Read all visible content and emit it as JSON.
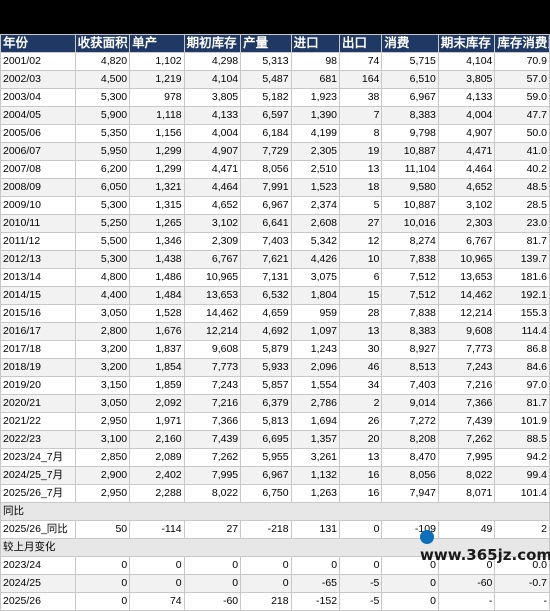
{
  "headers": [
    "年份",
    "收获面积",
    "单产",
    "期初库存",
    "产量",
    "进口",
    "出口",
    "消费",
    "期末库存",
    "库存消费比"
  ],
  "rows": [
    [
      "2001/02",
      "4,820",
      "1,102",
      "4,298",
      "5,313",
      "98",
      "74",
      "5,715",
      "4,104",
      "70.9"
    ],
    [
      "2002/03",
      "4,500",
      "1,219",
      "4,104",
      "5,487",
      "681",
      "164",
      "6,510",
      "3,805",
      "57.0"
    ],
    [
      "2003/04",
      "5,300",
      "978",
      "3,805",
      "5,182",
      "1,923",
      "38",
      "6,967",
      "4,133",
      "59.0"
    ],
    [
      "2004/05",
      "5,900",
      "1,118",
      "4,133",
      "6,597",
      "1,390",
      "7",
      "8,383",
      "4,004",
      "47.7"
    ],
    [
      "2005/06",
      "5,350",
      "1,156",
      "4,004",
      "6,184",
      "4,199",
      "8",
      "9,798",
      "4,907",
      "50.0"
    ],
    [
      "2006/07",
      "5,950",
      "1,299",
      "4,907",
      "7,729",
      "2,305",
      "19",
      "10,887",
      "4,471",
      "41.0"
    ],
    [
      "2007/08",
      "6,200",
      "1,299",
      "4,471",
      "8,056",
      "2,510",
      "13",
      "11,104",
      "4,464",
      "40.2"
    ],
    [
      "2008/09",
      "6,050",
      "1,321",
      "4,464",
      "7,991",
      "1,523",
      "18",
      "9,580",
      "4,652",
      "48.5"
    ],
    [
      "2009/10",
      "5,300",
      "1,315",
      "4,652",
      "6,967",
      "2,374",
      "5",
      "10,887",
      "3,102",
      "28.5"
    ],
    [
      "2010/11",
      "5,250",
      "1,265",
      "3,102",
      "6,641",
      "2,608",
      "27",
      "10,016",
      "2,303",
      "23.0"
    ],
    [
      "2011/12",
      "5,500",
      "1,346",
      "2,309",
      "7,403",
      "5,342",
      "12",
      "8,274",
      "6,767",
      "81.7"
    ],
    [
      "2012/13",
      "5,300",
      "1,438",
      "6,767",
      "7,621",
      "4,426",
      "10",
      "7,838",
      "10,965",
      "139.7"
    ],
    [
      "2013/14",
      "4,800",
      "1,486",
      "10,965",
      "7,131",
      "3,075",
      "6",
      "7,512",
      "13,653",
      "181.6"
    ],
    [
      "2014/15",
      "4,400",
      "1,484",
      "13,653",
      "6,532",
      "1,804",
      "15",
      "7,512",
      "14,462",
      "192.1"
    ],
    [
      "2015/16",
      "3,050",
      "1,528",
      "14,462",
      "4,659",
      "959",
      "28",
      "7,838",
      "12,214",
      "155.3"
    ],
    [
      "2016/17",
      "2,800",
      "1,676",
      "12,214",
      "4,692",
      "1,097",
      "13",
      "8,383",
      "9,608",
      "114.4"
    ],
    [
      "2017/18",
      "3,200",
      "1,837",
      "9,608",
      "5,879",
      "1,243",
      "30",
      "8,927",
      "7,773",
      "86.8"
    ],
    [
      "2018/19",
      "3,200",
      "1,854",
      "7,773",
      "5,933",
      "2,096",
      "46",
      "8,513",
      "7,243",
      "84.6"
    ],
    [
      "2019/20",
      "3,150",
      "1,859",
      "7,243",
      "5,857",
      "1,554",
      "34",
      "7,403",
      "7,216",
      "97.0"
    ],
    [
      "2020/21",
      "3,050",
      "2,092",
      "7,216",
      "6,379",
      "2,786",
      "2",
      "9,014",
      "7,366",
      "81.7"
    ],
    [
      "2021/22",
      "2,950",
      "1,971",
      "7,366",
      "5,813",
      "1,694",
      "26",
      "7,272",
      "7,439",
      "101.9"
    ],
    [
      "2022/23",
      "3,100",
      "2,160",
      "7,439",
      "6,695",
      "1,357",
      "20",
      "8,208",
      "7,262",
      "88.5"
    ],
    [
      "2023/24_7月",
      "2,850",
      "2,089",
      "7,262",
      "5,955",
      "3,261",
      "13",
      "8,470",
      "7,995",
      "94.2"
    ],
    [
      "2024/25_7月",
      "2,900",
      "2,402",
      "7,995",
      "6,967",
      "1,132",
      "16",
      "8,056",
      "8,022",
      "99.4"
    ],
    [
      "2025/26_7月",
      "2,950",
      "2,288",
      "8,022",
      "6,750",
      "1,263",
      "16",
      "7,947",
      "8,071",
      "101.4"
    ]
  ],
  "yoy_section": {
    "label": "同比",
    "rows": [
      [
        "2025/26_同比",
        "50",
        "-114",
        "27",
        "-218",
        "131",
        "0",
        "-109",
        "49",
        "2"
      ]
    ]
  },
  "mom_section": {
    "label": "较上月变化",
    "rows": [
      [
        "2023/24",
        "0",
        "0",
        "0",
        "0",
        "0",
        "0",
        "0",
        "0",
        "0.0"
      ],
      [
        "2024/25",
        "0",
        "0",
        "0",
        "0",
        "-65",
        "-5",
        "0",
        "-60",
        "-0.7"
      ],
      [
        "2025/26",
        "0",
        "74",
        "-60",
        "218",
        "-152",
        "-5",
        "0",
        "-",
        "-"
      ]
    ]
  },
  "watermark": "www.365jz.com"
}
